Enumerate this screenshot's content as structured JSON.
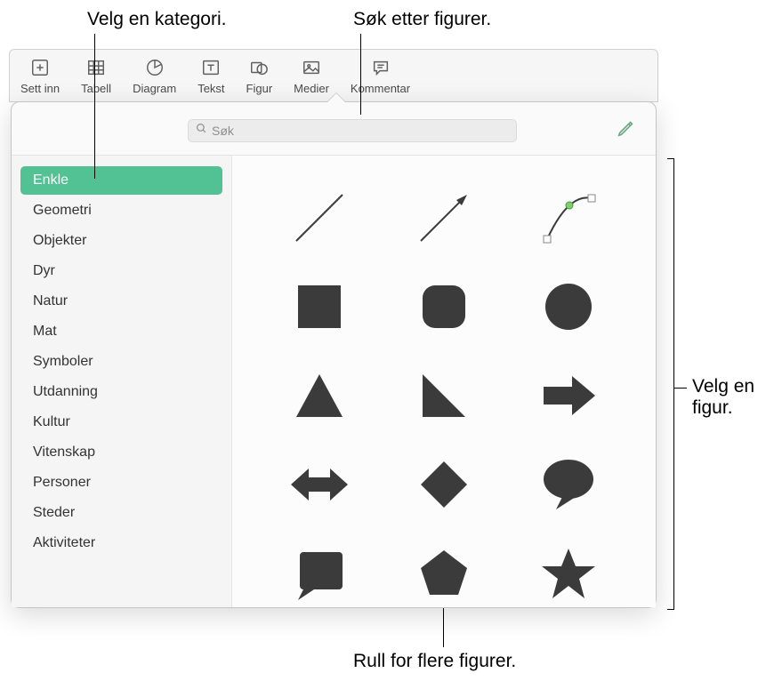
{
  "callouts": {
    "category": "Velg en kategori.",
    "search": "Søk etter figurer.",
    "select_shape": "Velg en figur.",
    "scroll": "Rull for flere figurer."
  },
  "toolbar": {
    "insert": "Sett inn",
    "table": "Tabell",
    "chart": "Diagram",
    "text": "Tekst",
    "shape": "Figur",
    "media": "Medier",
    "comment": "Kommentar"
  },
  "search": {
    "placeholder": "Søk"
  },
  "sidebar": {
    "items": [
      {
        "label": "Enkle",
        "selected": true
      },
      {
        "label": "Geometri",
        "selected": false
      },
      {
        "label": "Objekter",
        "selected": false
      },
      {
        "label": "Dyr",
        "selected": false
      },
      {
        "label": "Natur",
        "selected": false
      },
      {
        "label": "Mat",
        "selected": false
      },
      {
        "label": "Symboler",
        "selected": false
      },
      {
        "label": "Utdanning",
        "selected": false
      },
      {
        "label": "Kultur",
        "selected": false
      },
      {
        "label": "Vitenskap",
        "selected": false
      },
      {
        "label": "Personer",
        "selected": false
      },
      {
        "label": "Steder",
        "selected": false
      },
      {
        "label": "Aktiviteter",
        "selected": false
      }
    ]
  },
  "shapes": [
    {
      "name": "line"
    },
    {
      "name": "arrow-line"
    },
    {
      "name": "curve-editable"
    },
    {
      "name": "square"
    },
    {
      "name": "rounded-square"
    },
    {
      "name": "circle"
    },
    {
      "name": "triangle"
    },
    {
      "name": "right-triangle"
    },
    {
      "name": "arrow-right"
    },
    {
      "name": "arrow-bidirectional"
    },
    {
      "name": "diamond"
    },
    {
      "name": "speech-bubble"
    },
    {
      "name": "callout-square"
    },
    {
      "name": "pentagon"
    },
    {
      "name": "star"
    }
  ],
  "colors": {
    "shape": "#3b3b3b",
    "accent": "#52c193",
    "toolbar_icon": "#606060"
  }
}
